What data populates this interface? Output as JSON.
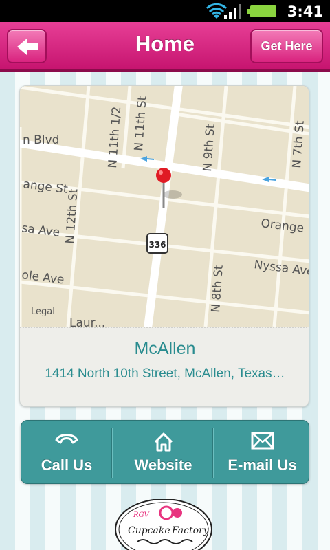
{
  "status_bar": {
    "time": "3:41"
  },
  "header": {
    "title": "Home",
    "right_button_label": "Get Here",
    "back_icon": "arrow-left-icon"
  },
  "map": {
    "legal": "Legal",
    "shield": "336",
    "streets": [
      "n Blvd",
      "N 11th 1/2",
      "N 11th St",
      "N 9th St",
      "N 7th St",
      "ange St",
      "N 12th St",
      "Orange",
      "sa Ave",
      "Nyssa Ave",
      "ole Ave",
      "N 8th St",
      "Laur..."
    ]
  },
  "location": {
    "city": "McAllen",
    "address": "1414 North 10th Street,  McAllen, Texas…"
  },
  "actions": [
    {
      "label": "Call Us",
      "icon": "phone-icon"
    },
    {
      "label": "Website",
      "icon": "home-icon"
    },
    {
      "label": "E-mail Us",
      "icon": "mail-icon"
    }
  ],
  "logo": {
    "text_top": "RGV",
    "text_main_left": "Cupcake",
    "text_main_right": "Factory"
  },
  "colors": {
    "header_pink": "#d9237f",
    "teal": "#3f9a9b",
    "text_teal": "#2a8c8f"
  }
}
